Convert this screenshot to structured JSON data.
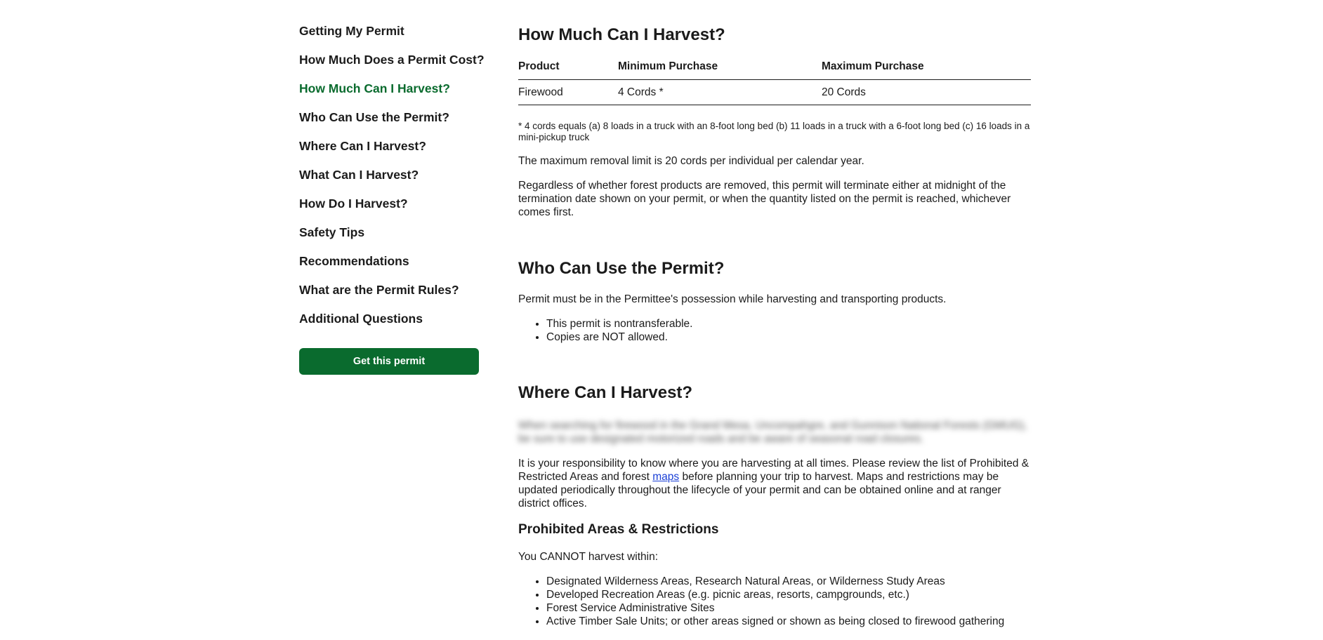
{
  "sidebar": {
    "items": [
      {
        "label": "Getting My Permit",
        "active": false
      },
      {
        "label": "How Much Does a Permit Cost?",
        "active": false
      },
      {
        "label": "How Much Can I Harvest?",
        "active": true
      },
      {
        "label": "Who Can Use the Permit?",
        "active": false
      },
      {
        "label": "Where Can I Harvest?",
        "active": false
      },
      {
        "label": "What Can I Harvest?",
        "active": false
      },
      {
        "label": "How Do I Harvest?",
        "active": false
      },
      {
        "label": "Safety Tips",
        "active": false
      },
      {
        "label": "Recommendations",
        "active": false
      },
      {
        "label": "What are the Permit Rules?",
        "active": false
      },
      {
        "label": "Additional Questions",
        "active": false
      }
    ],
    "get_permit_label": "Get this permit"
  },
  "harvest": {
    "title": "How Much Can I Harvest?",
    "table": {
      "headers": [
        "Product",
        "Minimum Purchase",
        "Maximum Purchase"
      ],
      "rows": [
        [
          "Firewood",
          "4 Cords *",
          "20 Cords"
        ]
      ]
    },
    "footnote": "* 4 cords equals (a) 8 loads in a truck with an 8-foot long bed (b) 11 loads in a truck with a 6-foot long bed (c) 16 loads in a mini-pickup truck",
    "limit_text": "The maximum removal limit is 20 cords per individual per calendar year.",
    "termination_text": "Regardless of whether forest products are removed, this permit will terminate either at midnight of the termination date shown on your permit, or when the quantity listed on the permit is reached, whichever comes first."
  },
  "who": {
    "title": "Who Can Use the Permit?",
    "intro": "Permit must be in the Permittee's possession while harvesting and transporting products.",
    "bullets": [
      "This permit is nontransferable.",
      "Copies are NOT allowed."
    ]
  },
  "where": {
    "title": "Where Can I Harvest?",
    "blurred_text": "When searching for firewood in the Grand Mesa, Uncompahgre, and Gunnison National Forests (GMUG), be sure to use designated motorized roads and be aware of seasonal road closures.",
    "responsibility_before": "It is your responsibility to know where you are harvesting at all times. Please review the list of Prohibited & Restricted Areas and forest ",
    "maps_link": "maps",
    "responsibility_after": " before planning your trip to harvest. Maps and restrictions may be updated periodically throughout the lifecycle of your permit and can be obtained online and at ranger district offices.",
    "prohibited_title": "Prohibited Areas & Restrictions",
    "cannot_text": "You CANNOT harvest within:",
    "prohibited_bullets": [
      "Designated Wilderness Areas, Research Natural Areas, or Wilderness Study Areas",
      "Developed Recreation Areas (e.g. picnic areas, resorts, campgrounds, etc.)",
      "Forest Service Administrative Sites",
      "Active Timber Sale Units; or other areas signed or shown as being closed to firewood gathering"
    ]
  },
  "colors": {
    "accent_green": "#0a6b2e",
    "link_blue": "#1a3fd6",
    "text": "#1b1b1b"
  }
}
